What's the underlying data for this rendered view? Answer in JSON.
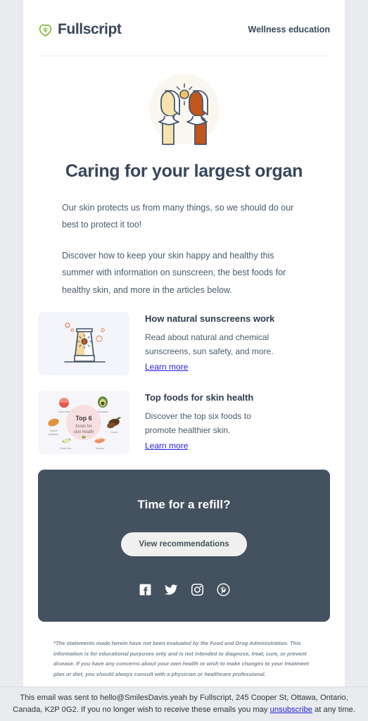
{
  "header": {
    "brand_name": "Fullscript",
    "brand_icon": "leaf-heart-logo",
    "tagline": "Wellness education"
  },
  "hero": {
    "illustration_name": "two-people-under-sun-illustration"
  },
  "intro": {
    "headline": "Caring for your largest organ",
    "paragraphs": [
      "Our skin protects us from many things, so we should do our best to protect it too!",
      "Discover how to keep your skin happy and healthy this summer with information on sunscreen, the best foods for healthy skin, and more in the articles below."
    ]
  },
  "articles": [
    {
      "thumb_name": "sunscreen-tube-illustration",
      "title": "How natural sunscreens work",
      "description": "Read about natural and chemical sunscreens, sun safety, and more.",
      "link_label": "Learn more"
    },
    {
      "thumb_name": "top-six-foods-infographic",
      "title": "Top foods for skin health",
      "description": "Discover the top six foods to promote healthier skin.",
      "link_label": "Learn more",
      "infographic": {
        "center_title": "Top 6",
        "center_subtitle": "foods for skin health",
        "foods": [
          "Citrus fruit",
          "Avocados",
          "Cocoa",
          "Salmon",
          "Green tea",
          "Sweet potatoes"
        ]
      }
    }
  ],
  "refill": {
    "title": "Time for a refill?",
    "button_label": "View recommendations",
    "socials": [
      {
        "name": "facebook-icon"
      },
      {
        "name": "twitter-icon"
      },
      {
        "name": "instagram-icon"
      },
      {
        "name": "pinterest-icon"
      }
    ]
  },
  "disclaimer": "*The statements made herein have not been evaluated by the Food and Drug Administration. This information is for educational purposes only and is not intended to diagnose, treat, cure, or prevent disease. If you have any concerns about your own health or wish to make changes to your treatment plan or diet, you should always consult with a physician or healthcare professional.",
  "footer": {
    "text_before_link": "This email was sent to hello@SmilesDavis.yeah by Fullscript, 245 Cooper St, Ottawa, Ontario, Canada, K2P 0G2. If you no longer wish to receive these emails you may ",
    "link_label": "unsubscribe",
    "text_after_link": " at any time."
  },
  "colors": {
    "page_background": "#e9ebee",
    "card_background": "#ffffff",
    "brand_green": "#8cb742",
    "navy": "#37465a",
    "body_text": "#4b5a6b",
    "link_blue": "#2222dd",
    "panel_dark": "#44515f",
    "button_light": "#f0f0ee"
  }
}
